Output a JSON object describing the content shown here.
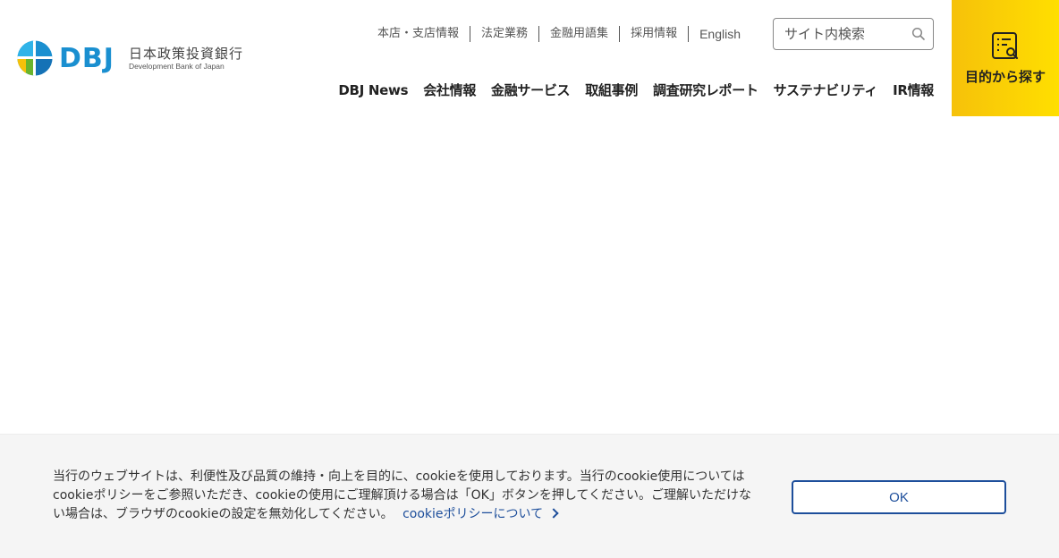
{
  "brand": {
    "logo_text": "DBJ",
    "name_ja": "日本政策投資銀行",
    "name_en": "Development Bank of Japan",
    "colors": {
      "blue": "#1a8fd0",
      "green": "#6ab42d",
      "yellow": "#f6c10a",
      "navy": "#1d4e9b"
    }
  },
  "util_nav": {
    "items": [
      {
        "label": "本店・支店情報"
      },
      {
        "label": "法定業務"
      },
      {
        "label": "金融用語集"
      },
      {
        "label": "採用情報"
      },
      {
        "label": "English"
      }
    ]
  },
  "search": {
    "placeholder": "サイト内検索",
    "icon": "search-icon"
  },
  "main_nav": {
    "items": [
      {
        "label": "DBJ News"
      },
      {
        "label": "会社情報"
      },
      {
        "label": "金融サービス"
      },
      {
        "label": "取組事例"
      },
      {
        "label": "調査研究レポート"
      },
      {
        "label": "サステナビリティ"
      },
      {
        "label": "IR情報"
      }
    ]
  },
  "purpose_button": {
    "label": "目的から探す",
    "icon": "checklist-search-icon",
    "color": "#f6c10a"
  },
  "cookie_banner": {
    "message": "当行のウェブサイトは、利便性及び品質の維持・向上を目的に、cookieを使用しております。当行のcookie使用については cookieポリシーをご参照いただき、cookieの使用にご理解頂ける場合は「OK」ボタンを押してください。ご理解いただけない場合は、ブラウザのcookieの設定を無効化してください。",
    "link_label": "cookieポリシーについて",
    "ok_label": "OK"
  }
}
